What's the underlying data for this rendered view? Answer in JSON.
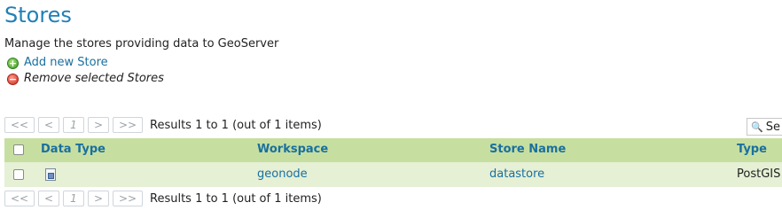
{
  "page": {
    "title": "Stores",
    "description": "Manage the stores providing data to GeoServer"
  },
  "actions": {
    "add_label": "Add new Store",
    "remove_label": "Remove selected Stores"
  },
  "pager": {
    "first": "<<",
    "prev": "<",
    "page": "1",
    "next": ">",
    "last": ">>",
    "results": "Results 1 to 1 (out of 1 items)"
  },
  "search": {
    "label": "Se"
  },
  "table": {
    "columns": [
      "Data Type",
      "Workspace",
      "Store Name",
      "Type"
    ],
    "rows": [
      {
        "workspace": "geonode",
        "store_name": "datastore",
        "type": "PostGIS"
      }
    ]
  },
  "colors": {
    "title": "#2180b6",
    "link": "#1a6f9f",
    "header_bg": "#c6dfa1",
    "row_bg": "#e5f0d5"
  },
  "icons": {
    "add": "add-circle-icon",
    "remove": "remove-circle-icon",
    "search": "magnifier-icon",
    "data_type": "vector-store-icon"
  }
}
